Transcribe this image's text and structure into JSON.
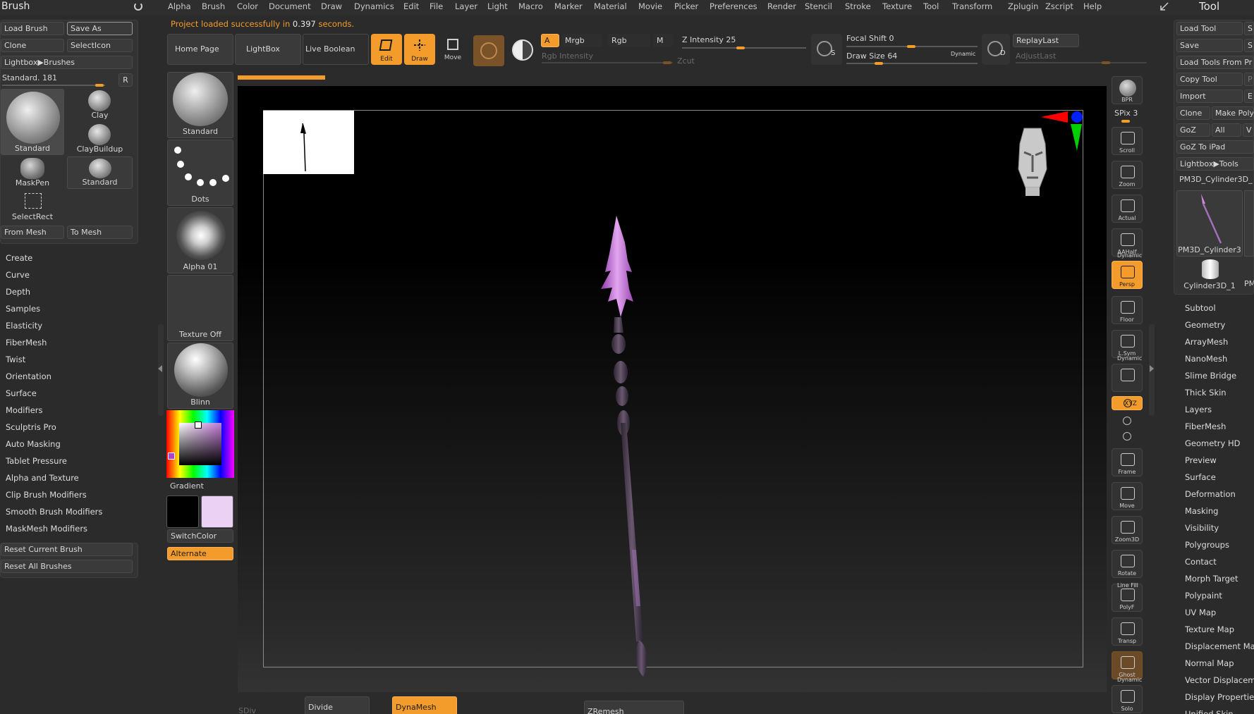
{
  "colors": {
    "bg": "#2b2b2b",
    "panel": "#3a3a3a",
    "accent": "#f39c2b",
    "canvas": "#000000",
    "spear_tip": "#c27ad6",
    "status_text": "#f39c2b"
  },
  "menubar": {
    "items": [
      "Alpha",
      "Brush",
      "Color",
      "Document",
      "Draw",
      "Dynamics",
      "Edit",
      "File",
      "Layer",
      "Light",
      "Macro",
      "Marker",
      "Material",
      "Movie",
      "Picker",
      "Preferences",
      "Render",
      "Stencil",
      "Stroke",
      "Texture",
      "Tool",
      "Transform",
      "Zplugin",
      "Zscript",
      "Help"
    ]
  },
  "status": {
    "prefix": "Project loaded successfully in ",
    "time": "0.397",
    "suffix": " seconds."
  },
  "brush_panel": {
    "title": "Brush",
    "load_brush": "Load Brush",
    "save_as": "Save As",
    "clone": "Clone",
    "select_icon": "SelectIcon",
    "lightbox_brushes": "Lightbox▶Brushes",
    "standard_slider": "Standard. 181",
    "r_button": "R",
    "thumbs": [
      "Standard",
      "Clay",
      "ClayBuildup",
      "MaskPen",
      "Standard",
      "SelectRect"
    ],
    "from_mesh": "From Mesh",
    "to_mesh": "To Mesh",
    "sections": [
      "Create",
      "Curve",
      "Depth",
      "Samples",
      "Elasticity",
      "FiberMesh",
      "Twist",
      "Orientation",
      "Surface",
      "Modifiers",
      "Sculptris Pro",
      "Auto Masking",
      "Tablet Pressure",
      "Alpha and Texture",
      "Clip Brush Modifiers",
      "Smooth Brush Modifiers",
      "MaskMesh Modifiers"
    ],
    "reset_current": "Reset Current Brush",
    "reset_all": "Reset All Brushes"
  },
  "left_shelf": {
    "standard": "Standard",
    "dots": "Dots",
    "alpha": "Alpha 01",
    "texture": "Texture Off",
    "material": "Blinn",
    "gradient": "Gradient",
    "switch_color": "SwitchColor",
    "alternate": "Alternate"
  },
  "top_toolbar": {
    "home_page": "Home Page",
    "lightbox": "LightBox",
    "live_boolean": "Live Boolean",
    "edit": "Edit",
    "draw": "Draw",
    "move": "Move",
    "a": "A",
    "mrgb": "Mrgb",
    "rgb": "Rgb",
    "m": "M",
    "rgb_intensity": "Rgb Intensity",
    "z_intensity_label": "Z Intensity",
    "z_intensity": "25",
    "zcut": "Zcut",
    "focal_shift_label": "Focal Shift",
    "focal_shift": "0",
    "draw_size_label": "Draw Size",
    "draw_size": "64",
    "dynamic": "Dynamic",
    "replay_last": "ReplayLast",
    "adjust_last": "AdjustLast"
  },
  "right_toolbar": {
    "bpr": "BPR",
    "spix": "SPix 3",
    "items": [
      "Scroll",
      "Zoom",
      "Actual",
      "AAHalf",
      "Persp",
      "Floor",
      "L.Sym",
      "",
      "XYZ",
      "",
      "",
      "Frame",
      "Move",
      "Zoom3D",
      "Rotate",
      "PolyF",
      "Transp",
      "Ghost",
      "Solo"
    ],
    "dynamic": "Dynamic",
    "line_fill": "Line Fill"
  },
  "tool_panel": {
    "title": "Tool",
    "load_tool": "Load Tool",
    "save": "Save",
    "load_tools_from": "Load Tools From Pr",
    "copy_tool": "Copy Tool",
    "import": "Import",
    "clone": "Clone",
    "make_poly": "Make Poly",
    "goz": "GoZ",
    "all": "All",
    "goz_ipad": "GoZ To iPad",
    "lightbox_tools": "Lightbox▶Tools",
    "current_tool": "PM3D_Cylinder3D_",
    "thumb1": "PM3D_Cylinder3",
    "thumb2": "Cylinder3D_1",
    "sections": [
      "Subtool",
      "Geometry",
      "ArrayMesh",
      "NanoMesh",
      "Slime Bridge",
      "Thick Skin",
      "Layers",
      "FiberMesh",
      "Geometry HD",
      "Preview",
      "Surface",
      "Deformation",
      "Masking",
      "Visibility",
      "Polygroups",
      "Contact",
      "Morph Target",
      "Polypaint",
      "UV Map",
      "Texture Map",
      "Displacement Map",
      "Normal Map",
      "Vector Displaceme",
      "Display Properties",
      "Unified Skin"
    ]
  },
  "bottom_bar": {
    "sdiv": "SDiv",
    "divide": "Divide",
    "dynamesh": "DynaMesh",
    "zremesher": "ZRemesh"
  }
}
